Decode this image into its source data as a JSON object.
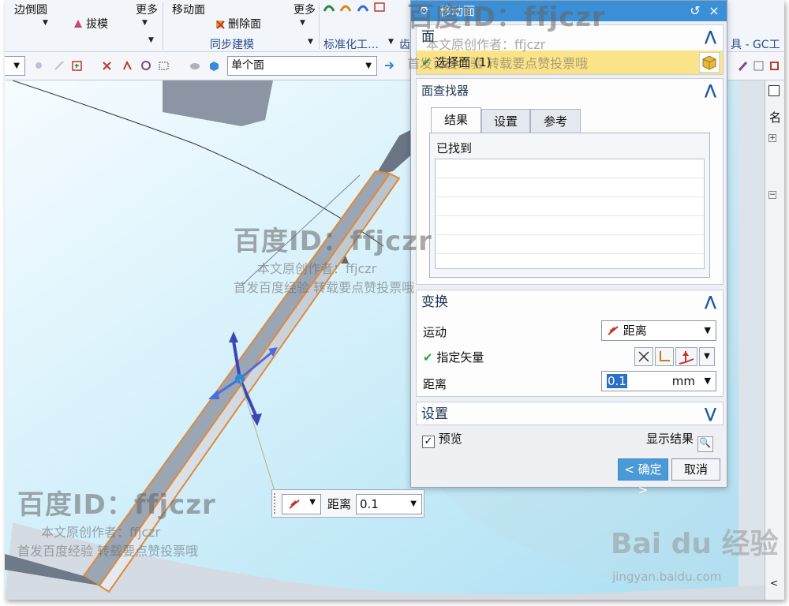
{
  "ribbon": {
    "edge_blend": "边倒圆",
    "draft": "拔模",
    "more_1": "更多",
    "move_face": "移动面",
    "delete_face": "删除面",
    "more_2": "更多",
    "sync_modeling": "同步建模",
    "standardization": "标准化工…",
    "gear": "齿",
    "gc_toolkit": "具 - GC工"
  },
  "toolbar": {
    "filter_value": "单个面"
  },
  "dialog": {
    "title": "移动面",
    "face_section": "面",
    "select_face": "选择面 (1)",
    "face_finder": "面查找器",
    "tabs": [
      "结果",
      "设置",
      "参考"
    ],
    "found_label": "已找到",
    "transform_section": "变换",
    "motion_label": "运动",
    "motion_value": "距离",
    "vector_label": "指定矢量",
    "distance_label": "距离",
    "distance_value": "0.1",
    "distance_unit": "mm",
    "settings_section": "设置",
    "preview_label": "预览",
    "show_result": "显示结果",
    "ok": "< 确定 >",
    "cancel": "取消"
  },
  "floating_handle": {
    "label": "距离",
    "value": "0.1"
  },
  "right_panel": {
    "name_column": "名"
  },
  "watermark": {
    "id_text": "百度ID：ffjczr",
    "author": "本文原创作者：ffjczr",
    "notice": "首发百度经验 转载要点赞投票哦",
    "logo": "Bai du 经验",
    "site": "jingyan.baidu.com"
  },
  "colors": {
    "accent": "#3b8fd6",
    "highlight": "#fbe38a",
    "check": "#2aa43a",
    "part_edge": "#e08a3a",
    "viewport": "#cfeefa"
  }
}
